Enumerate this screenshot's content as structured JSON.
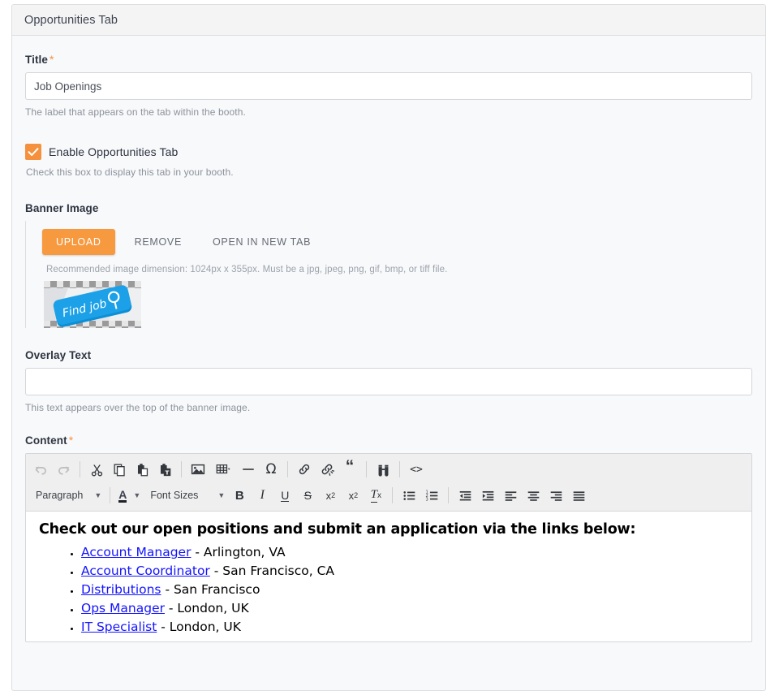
{
  "card": {
    "header_title": "Opportunities Tab"
  },
  "form": {
    "title_field": {
      "label": "Title",
      "required_mark": "*",
      "value": "Job Openings",
      "placeholder": "",
      "help": "The label that appears on the tab within the booth."
    },
    "enable_checkbox": {
      "label": "Enable Opportunities Tab",
      "checked": true,
      "help": "Check this box to display this tab in your booth.",
      "color": "#f5913e"
    },
    "banner_image": {
      "label": "Banner Image",
      "upload_label": "UPLOAD",
      "remove_label": "REMOVE",
      "open_label": "OPEN IN NEW TAB",
      "help": "Recommended image dimension: 1024px x 355px. Must be a jpg, jpeg, png, gif, bmp, or tiff file.",
      "thumbnail_alt": "Find job",
      "upload_button_color": "#f7993f"
    },
    "overlay_text_field": {
      "label": "Overlay Text",
      "value": "",
      "placeholder": "",
      "help": "This text appears over the top of the banner image."
    },
    "content_field": {
      "label": "Content",
      "required_mark": "*"
    }
  },
  "editor": {
    "toolbar_row1": [
      {
        "name": "undo-icon",
        "title": "Undo",
        "disabled": true
      },
      {
        "name": "redo-icon",
        "title": "Redo",
        "disabled": true
      },
      {
        "name": "separator"
      },
      {
        "name": "cut-icon",
        "title": "Cut"
      },
      {
        "name": "copy-icon",
        "title": "Copy"
      },
      {
        "name": "paste-icon",
        "title": "Paste"
      },
      {
        "name": "paste-as-text-icon",
        "title": "Paste as text"
      },
      {
        "name": "separator"
      },
      {
        "name": "image-icon",
        "title": "Insert image"
      },
      {
        "name": "table-icon",
        "title": "Table",
        "caret": true
      },
      {
        "name": "horizontal-rule-icon",
        "title": "Horizontal line"
      },
      {
        "name": "special-character-icon",
        "title": "Special character",
        "glyph": "Ω"
      },
      {
        "name": "separator"
      },
      {
        "name": "link-icon",
        "title": "Insert link"
      },
      {
        "name": "unlink-icon",
        "title": "Remove link"
      },
      {
        "name": "blockquote-icon",
        "title": "Blockquote",
        "glyph": "“"
      },
      {
        "name": "separator"
      },
      {
        "name": "find-replace-icon",
        "title": "Find and replace"
      },
      {
        "name": "separator"
      },
      {
        "name": "source-code-icon",
        "title": "Source code",
        "glyph": "<>"
      }
    ],
    "toolbar_row2": {
      "paragraph_select": "Paragraph",
      "text_color_label": "A",
      "font_sizes_select": "Font Sizes",
      "buttons": [
        {
          "name": "bold-icon",
          "glyph": "B",
          "title": "Bold"
        },
        {
          "name": "italic-icon",
          "glyph": "I",
          "title": "Italic"
        },
        {
          "name": "underline-icon",
          "glyph": "U",
          "title": "Underline"
        },
        {
          "name": "strikethrough-icon",
          "glyph": "S",
          "title": "Strikethrough"
        },
        {
          "name": "subscript-icon",
          "glyph": "x",
          "title": "Subscript"
        },
        {
          "name": "superscript-icon",
          "glyph": "x",
          "title": "Superscript"
        },
        {
          "name": "remove-format-icon",
          "glyph": "T",
          "title": "Clear formatting"
        },
        {
          "name": "bullet-list-icon",
          "title": "Bullet list"
        },
        {
          "name": "numbered-list-icon",
          "title": "Numbered list"
        },
        {
          "name": "outdent-icon",
          "title": "Decrease indent"
        },
        {
          "name": "indent-icon",
          "title": "Increase indent"
        },
        {
          "name": "align-left-icon",
          "title": "Align left"
        },
        {
          "name": "align-center-icon",
          "title": "Align center"
        },
        {
          "name": "align-right-icon",
          "title": "Align right"
        },
        {
          "name": "align-justify-icon",
          "title": "Justify"
        }
      ]
    },
    "content": {
      "heading": "Check out our open positions and submit an application via the links below:",
      "items": [
        {
          "link": "Account Manager",
          "rest": " - Arlington, VA"
        },
        {
          "link": "Account Coordinator",
          "rest": " - San Francisco, CA"
        },
        {
          "link": "Distributions",
          "rest": " - San Francisco"
        },
        {
          "link": "Ops Manager",
          "rest": " - London, UK"
        },
        {
          "link": "IT Specialist",
          "rest": " - London, UK"
        }
      ]
    }
  }
}
